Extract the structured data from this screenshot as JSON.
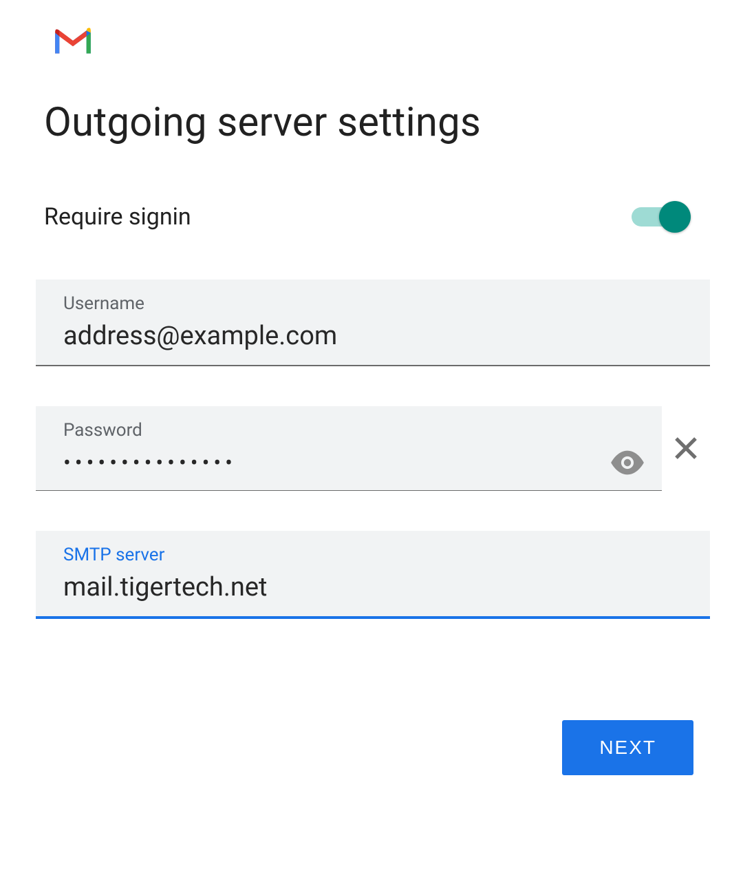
{
  "title": "Outgoing server settings",
  "require_signin": {
    "label": "Require signin",
    "enabled": true
  },
  "fields": {
    "username": {
      "label": "Username",
      "value": "address@example.com",
      "focused": false
    },
    "password": {
      "label": "Password",
      "value": "•••••••••••••••",
      "masked": true,
      "focused": false
    },
    "smtp_server": {
      "label": "SMTP server",
      "value": "mail.tigertech.net",
      "focused": true
    }
  },
  "actions": {
    "next": "NEXT"
  },
  "icons": {
    "logo": "gmail-logo",
    "toggle_password": "eye-icon",
    "clear_password": "close-icon"
  },
  "colors": {
    "primary_blue": "#1a73e8",
    "teal": "#00897B",
    "field_bg": "#f1f3f4",
    "text": "#202124",
    "muted": "#5f6368"
  }
}
